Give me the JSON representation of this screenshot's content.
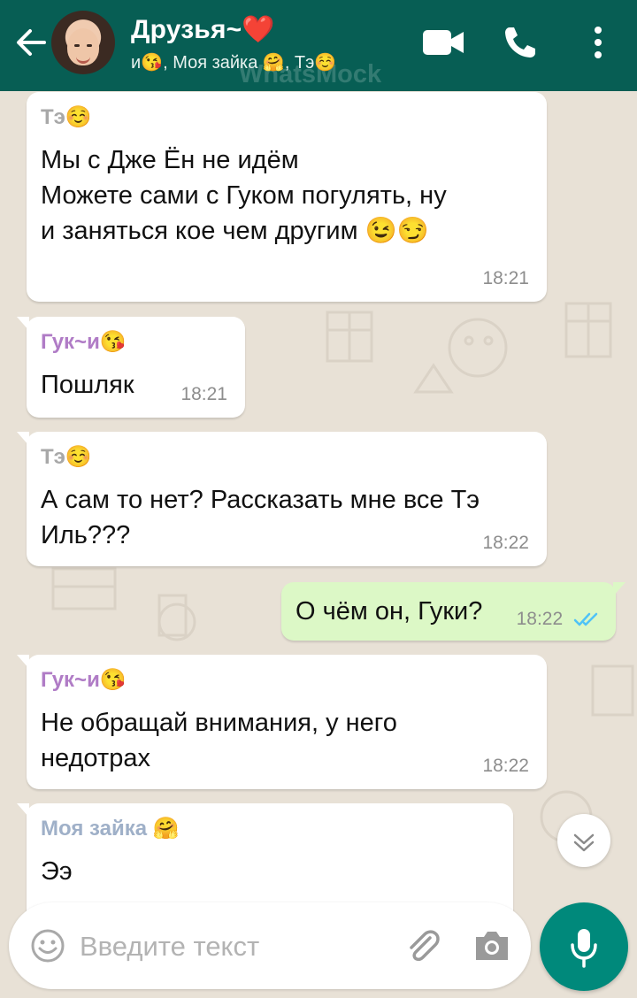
{
  "header": {
    "title": "Друзья~❤️",
    "subtitle": "и😘, Моя зайка 🤗, Тэ☺️",
    "watermark": "WhatsMock"
  },
  "messages": [
    {
      "sender": "Тэ☺️",
      "sender_color": "#a8a8a8",
      "text": "Мы с Дже Ён не идём\nМожете сами с Гуком погулять, ну\nи заняться кое чем другим 😉😏",
      "time": "18:21",
      "direction": "in"
    },
    {
      "sender": "Гук~и😘",
      "sender_color": "#b07cc6",
      "text": "Пошляк",
      "time": "18:21",
      "direction": "in"
    },
    {
      "sender": "Тэ☺️",
      "sender_color": "#a8a8a8",
      "text": "А сам то нет? Рассказать мне все Тэ\nИль???",
      "time": "18:22",
      "direction": "in"
    },
    {
      "text": "О чём он, Гуки?",
      "time": "18:22",
      "direction": "out",
      "status": "read"
    },
    {
      "sender": "Гук~и😘",
      "sender_color": "#b07cc6",
      "text": "Не обращай внимания, у него\nнедотрах",
      "time": "18:22",
      "direction": "in"
    },
    {
      "sender": "Моя зайка 🤗",
      "sender_color": "#9fb0c8",
      "text": "Ээ",
      "direction": "in"
    }
  ],
  "composer": {
    "placeholder": "Введите текст"
  },
  "colors": {
    "header_bg": "#075e54",
    "outgoing_bubble": "#dcf8c6",
    "read_ticks": "#4fc3f7",
    "mic_button": "#00897b"
  },
  "icons": [
    "back-arrow-icon",
    "video-call-icon",
    "phone-icon",
    "more-options-icon",
    "scroll-down-icon",
    "emoji-icon",
    "attach-icon",
    "camera-icon",
    "mic-icon"
  ]
}
